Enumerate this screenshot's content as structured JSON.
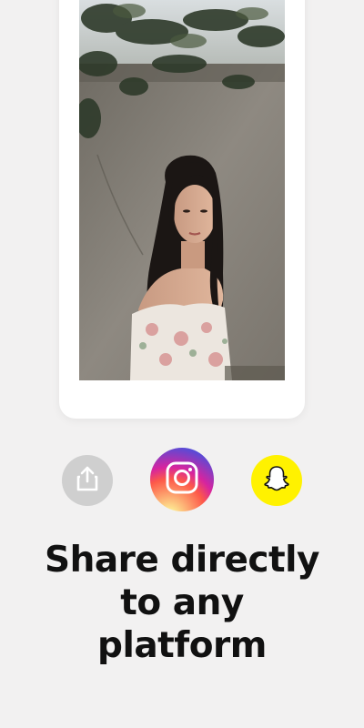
{
  "headline": {
    "line1": "Share directly",
    "line2": "to any",
    "line3": "platform"
  },
  "share_buttons": [
    {
      "name": "share",
      "icon": "share-upload-icon",
      "color": "#cfcfcf"
    },
    {
      "name": "instagram",
      "icon": "instagram-icon",
      "color": "#d6249f"
    },
    {
      "name": "snapchat",
      "icon": "snapchat-ghost-icon",
      "color": "#fff200"
    }
  ],
  "colors": {
    "background": "#f2f1f1",
    "frame": "#ffffff",
    "text": "#111111"
  },
  "preview": {
    "content": "photo"
  }
}
